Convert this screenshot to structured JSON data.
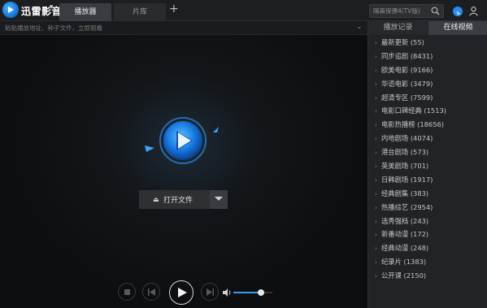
{
  "app": {
    "name": "迅雷影音",
    "dropdown": "▾"
  },
  "tabs": [
    {
      "label": "播放器"
    },
    {
      "label": "片库"
    }
  ],
  "tab_add": "+",
  "search": {
    "placeholder": "隔离保镖4(TV版)"
  },
  "url_bar": {
    "placeholder": "粘贴播放地址、种子文件，立即观看"
  },
  "player": {
    "open_file_label": "打开文件",
    "volume_level": 0.7
  },
  "side_panel": {
    "tabs": [
      {
        "label": "播放记录"
      },
      {
        "label": "在线视频"
      }
    ],
    "active_tab": 1,
    "items": [
      {
        "label": "最新更新 (55)"
      },
      {
        "label": "同步追剧 (8431)"
      },
      {
        "label": "欧美电影 (9166)"
      },
      {
        "label": "华语电影 (3479)"
      },
      {
        "label": "超清专区 (7599)"
      },
      {
        "label": "电影口碑经典 (1513)"
      },
      {
        "label": "电影热播榜 (18656)"
      },
      {
        "label": "内地剧场 (4074)"
      },
      {
        "label": "港台剧场 (573)"
      },
      {
        "label": "英美剧场 (701)"
      },
      {
        "label": "日韩剧场 (1917)"
      },
      {
        "label": "经典剧集 (383)"
      },
      {
        "label": "热播综艺 (2954)"
      },
      {
        "label": "选秀强档 (243)"
      },
      {
        "label": "新番动漫 (172)"
      },
      {
        "label": "经典动漫 (248)"
      },
      {
        "label": "纪录片 (1383)"
      },
      {
        "label": "公开课 (2150)"
      }
    ]
  },
  "colors": {
    "accent": "#2a8cf0",
    "background": "#101012",
    "panel": "#222326"
  }
}
